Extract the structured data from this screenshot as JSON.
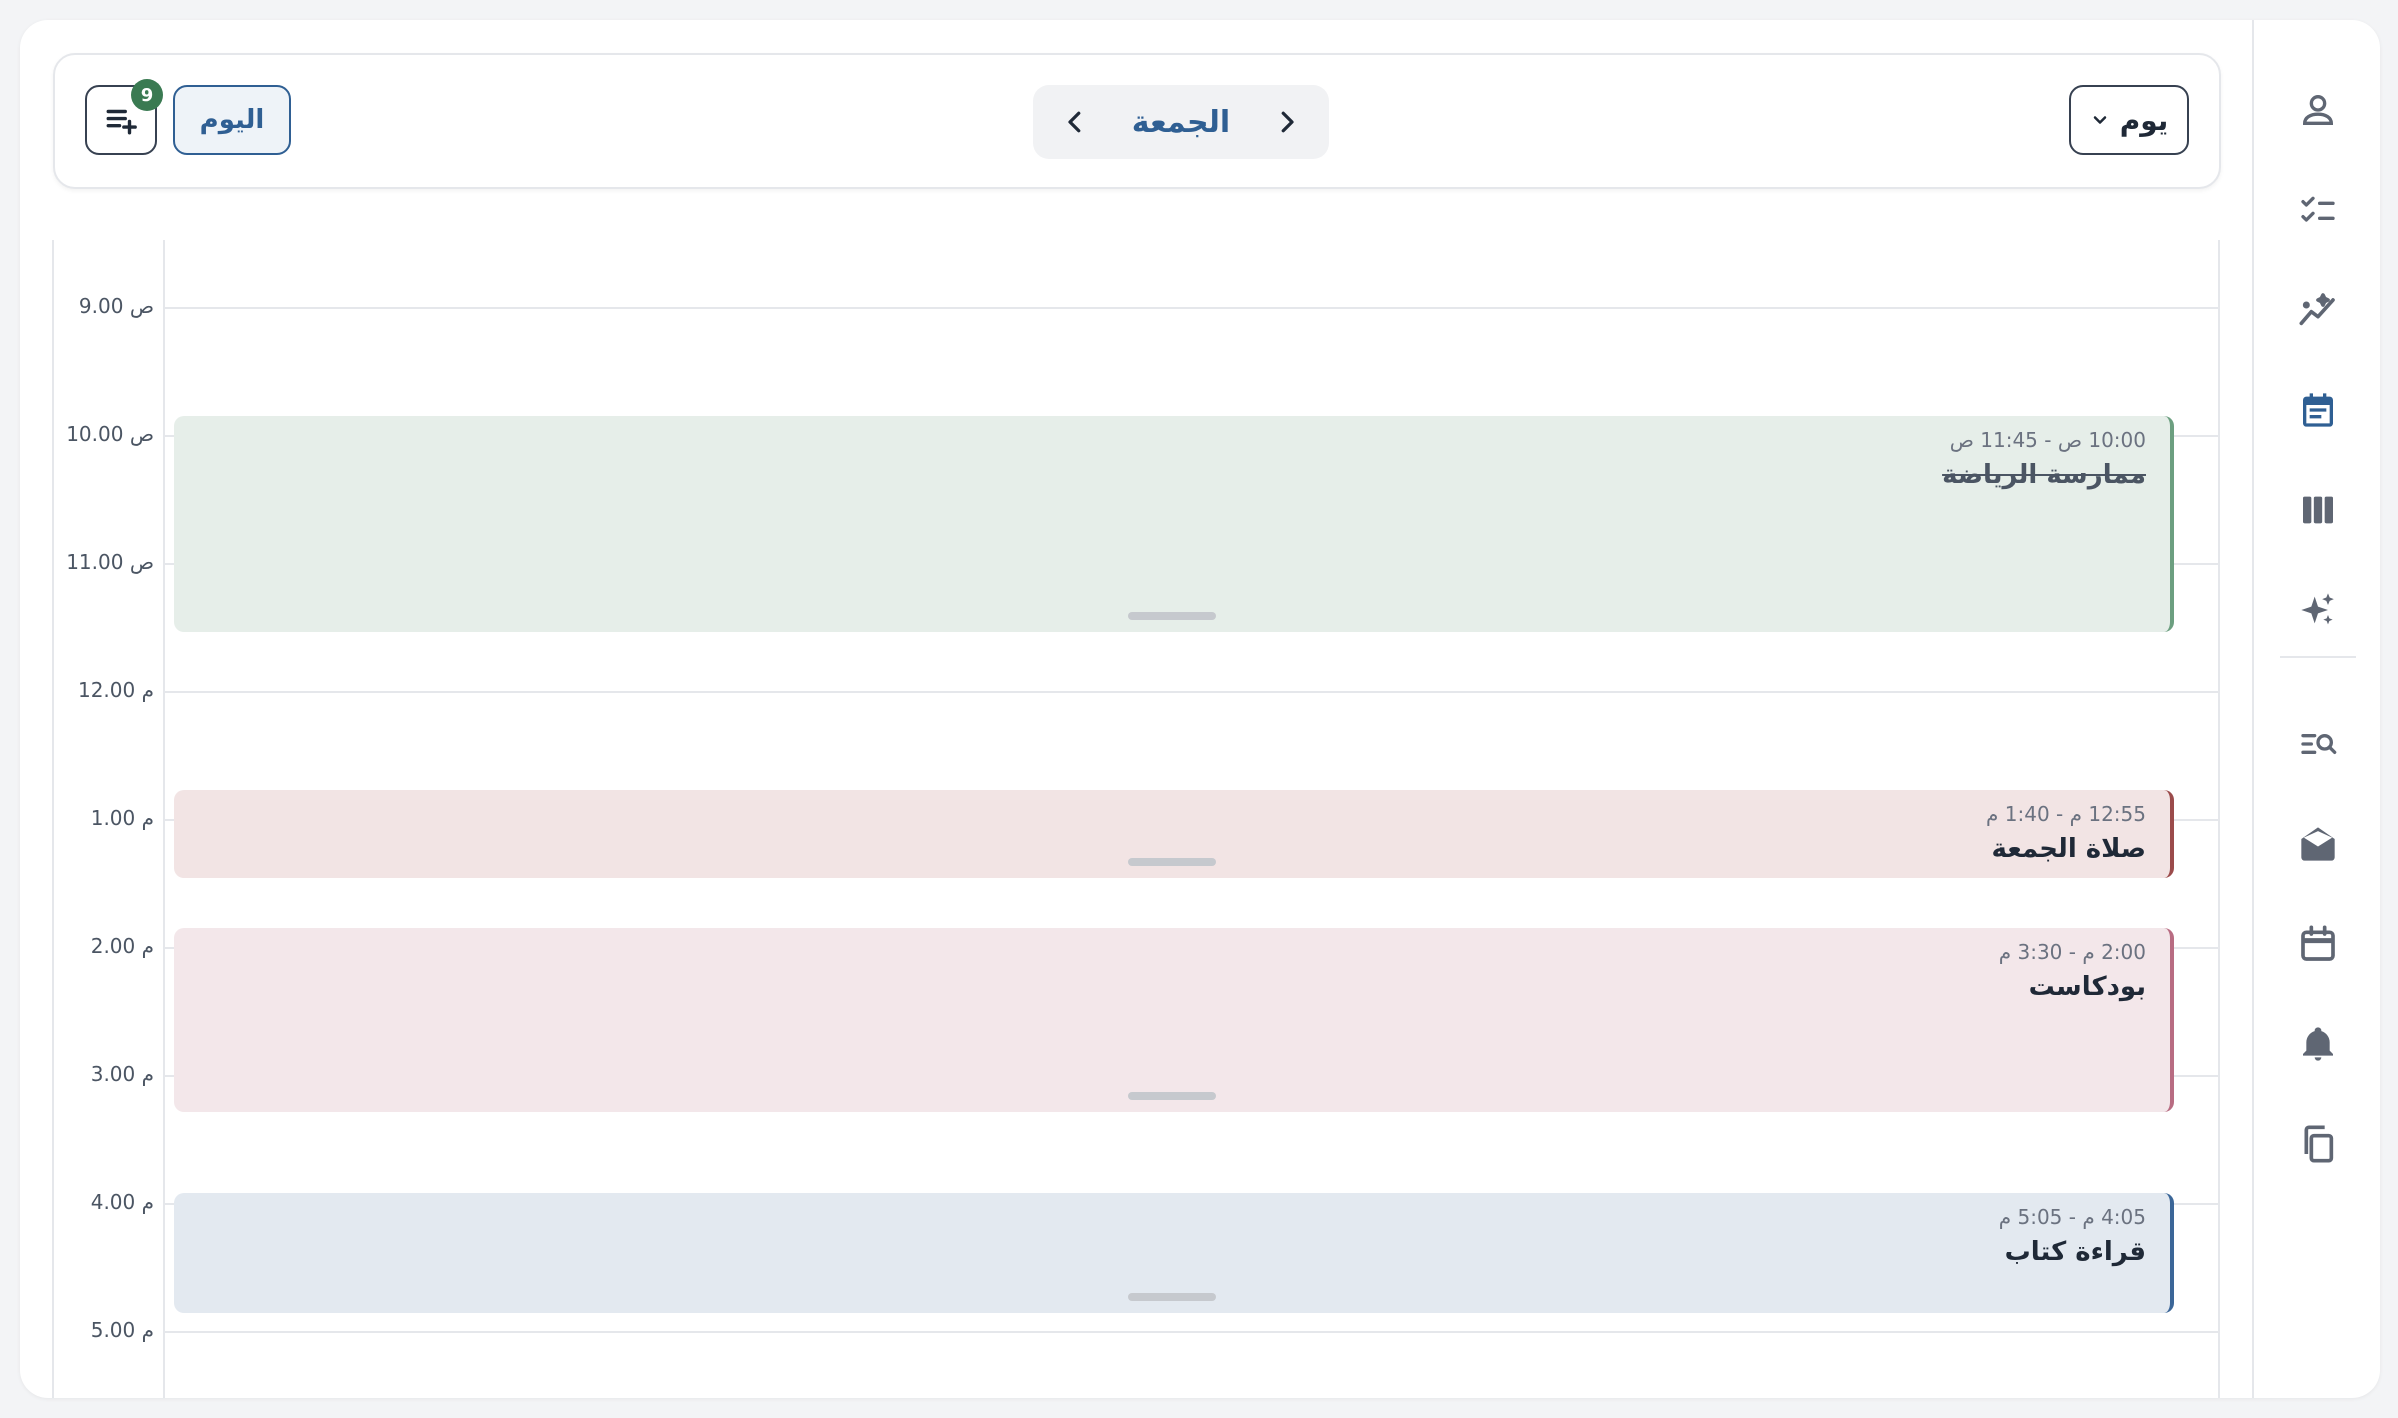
{
  "toolbar": {
    "view_mode": "يوم",
    "date_label": "الجمعة",
    "today_label": "اليوم",
    "queue_count": "9"
  },
  "sidebar": {
    "items": [
      {
        "icon": "person-icon"
      },
      {
        "icon": "checklist-icon"
      },
      {
        "icon": "analytics-icon"
      },
      {
        "icon": "calendar-event-icon",
        "active": true
      },
      {
        "icon": "columns-icon"
      },
      {
        "icon": "sparkles-icon"
      },
      {
        "icon": "search-list-icon"
      },
      {
        "icon": "mail-open-icon"
      },
      {
        "icon": "calendar-icon"
      },
      {
        "icon": "bell-icon"
      },
      {
        "icon": "copy-icon"
      }
    ]
  },
  "calendar": {
    "hours": [
      "9.00 ص",
      "10.00 ص",
      "11.00 ص",
      "12.00 م",
      "1.00 م",
      "2.00 م",
      "3.00 م",
      "4.00 م",
      "5.00 م"
    ],
    "events": [
      {
        "time": "10:00 ص - 11:45 ص",
        "title": "ممارسة الرياضة",
        "done": true,
        "color": "#6c9f80"
      },
      {
        "time": "12:55 م - 1:40 م",
        "title": "صلاة الجمعة",
        "done": false,
        "color": "#9b4b4b"
      },
      {
        "time": "2:00 م - 3:30 م",
        "title": "بودكاست",
        "done": false,
        "color": "#b86c82"
      },
      {
        "time": "4:05 م - 5:05 م",
        "title": "قراءة كتاب",
        "done": false,
        "color": "#3b6698"
      }
    ]
  }
}
